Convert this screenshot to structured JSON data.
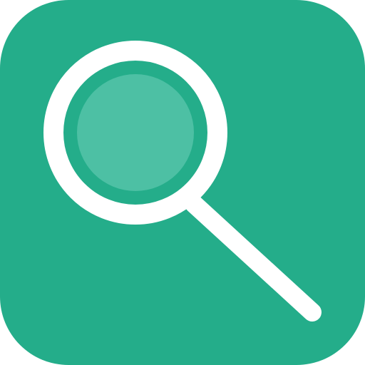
{
  "icon": {
    "name": "search-icon",
    "background_color": "#24AD8A",
    "ring_color": "#FFFFFF",
    "lens_color": "#4DC0A4",
    "handle_color": "#FFFFFF"
  }
}
